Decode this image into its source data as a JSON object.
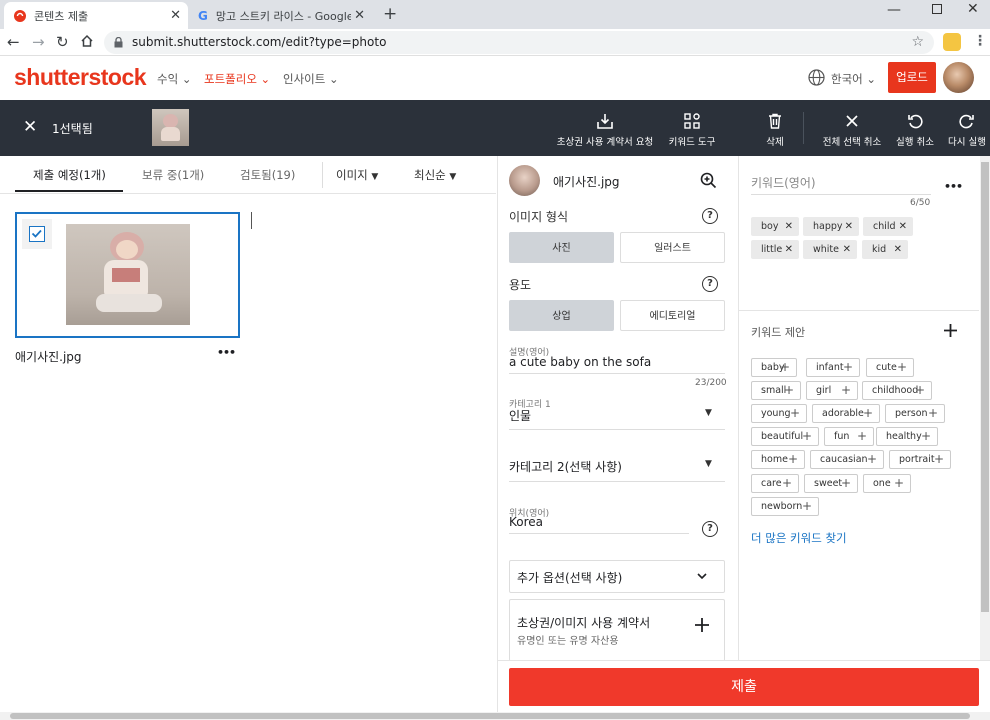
{
  "browser": {
    "tabs": [
      {
        "title": "콘텐츠 제출",
        "active": true
      },
      {
        "title": "망고 스트키 라이스 - Google 검",
        "active": false
      }
    ],
    "new_tab": "+",
    "url": "submit.shutterstock.com/edit?type=photo",
    "window_controls": [
      "minimize",
      "maximize",
      "close"
    ]
  },
  "site": {
    "logo": "shutterstock",
    "nav": [
      "수익",
      "포트폴리오",
      "인사이트"
    ],
    "language": "한국어",
    "upload_button": "업로드"
  },
  "action_bar": {
    "selected_count": "1선택됨",
    "actions": [
      "초상권 사용 계약서 요청",
      "키워드 도구",
      "삭제",
      "전체 선택 취소",
      "실행 취소",
      "다시 실행"
    ]
  },
  "left_panel": {
    "tabs": [
      "제출 예정(1개)",
      "보류 중(1개)",
      "검토됨(19)"
    ],
    "filter_type": "이미지",
    "sort": "최신순",
    "file_name": "애기사진.jpg",
    "more": "•••"
  },
  "editor": {
    "file_name": "애기사진.jpg",
    "image_type_label": "이미지 형식",
    "image_types": [
      "사진",
      "일러스트"
    ],
    "image_type_selected": "사진",
    "usage_label": "용도",
    "usages": [
      "상업",
      "에디토리얼"
    ],
    "usage_selected": "상업",
    "description_label": "설명(영어)",
    "description_value": "a cute baby on the sofa",
    "description_count": "23/200",
    "category1_label": "카테고리 1",
    "category1_value": "인물",
    "category2_placeholder": "카테고리 2(선택 사항)",
    "location_label": "위치(영어)",
    "location_value": "Korea",
    "extra_options": "추가 옵션(선택 사항)",
    "release_title": "초상권/이미지 사용 계약서",
    "release_subtitle": "유명인 또는 유명 자산용",
    "help": "?"
  },
  "keywords": {
    "placeholder": "키워드(영어)",
    "count": "6/50",
    "items": [
      "boy",
      "happy",
      "child",
      "little",
      "white",
      "kid"
    ],
    "suggest_label": "키워드 제안",
    "suggestions": [
      "baby",
      "infant",
      "cute",
      "small",
      "girl",
      "childhood",
      "young",
      "adorable",
      "person",
      "beautiful",
      "fun",
      "healthy",
      "home",
      "caucasian",
      "portrait",
      "care",
      "sweet",
      "one",
      "newborn"
    ],
    "more_link": "더 많은 키워드 찾기",
    "more": "•••"
  },
  "submit_button": "제출",
  "colors": {
    "brand": "#e8361d",
    "dark_bar": "#2b313a",
    "selected_border": "#1a74c4"
  }
}
